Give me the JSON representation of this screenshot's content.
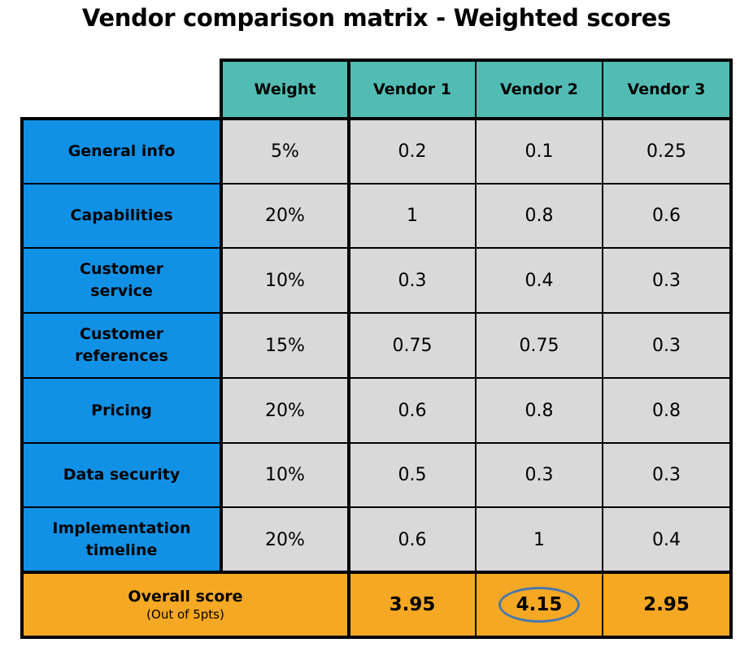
{
  "title": "Vendor comparison matrix - Weighted scores",
  "columns": [
    "Weight",
    "Vendor 1",
    "Vendor 2",
    "Vendor 3"
  ],
  "rows": [
    {
      "criterion": "General info",
      "weight": "5%",
      "scores": [
        "0.2",
        "0.1",
        "0.25"
      ]
    },
    {
      "criterion": "Capabilities",
      "weight": "20%",
      "scores": [
        "1",
        "0.8",
        "0.6"
      ]
    },
    {
      "criterion": "Customer service",
      "weight": "10%",
      "scores": [
        "0.3",
        "0.4",
        "0.3"
      ]
    },
    {
      "criterion": "Customer references",
      "weight": "15%",
      "scores": [
        "0.75",
        "0.75",
        "0.3"
      ]
    },
    {
      "criterion": "Pricing",
      "weight": "20%",
      "scores": [
        "0.6",
        "0.8",
        "0.8"
      ]
    },
    {
      "criterion": "Data security",
      "weight": "10%",
      "scores": [
        "0.5",
        "0.3",
        "0.3"
      ]
    },
    {
      "criterion": "Implementation timeline",
      "weight": "20%",
      "scores": [
        "0.6",
        "1",
        "0.4"
      ]
    }
  ],
  "overall": {
    "label": "Overall score",
    "sublabel": "(Out of 5pts)",
    "scores": [
      "3.95",
      "4.15",
      "2.95"
    ],
    "highlighted_vendor": "Vendor 2"
  },
  "colors": {
    "header": "#52bcb3",
    "criterion": "#1191e6",
    "value": "#d9d9d9",
    "overall": "#f5a823",
    "highlight_ring": "#4a78ad"
  }
}
